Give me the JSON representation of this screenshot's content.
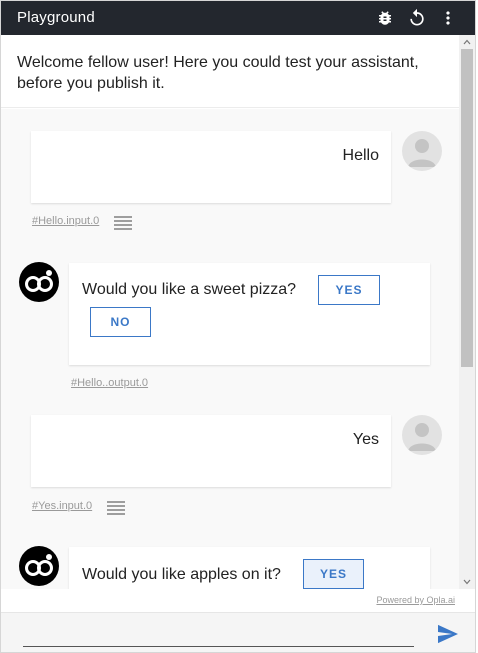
{
  "header": {
    "title": "Playground",
    "bug_icon": "bug-icon",
    "reset_icon": "restart-icon",
    "menu_icon": "more-vert-icon"
  },
  "welcome": {
    "text": "Welcome fellow user! Here you could test your assistant, before you publish it."
  },
  "messages": [
    {
      "from": "user",
      "text": "Hello",
      "tag": "#Hello.input.0"
    },
    {
      "from": "bot",
      "text": "Would you like a sweet pizza?",
      "buttons": [
        "YES",
        "NO"
      ],
      "tag": "#Hello..output.0"
    },
    {
      "from": "user",
      "text": "Yes",
      "tag": "#Yes.input.0"
    },
    {
      "from": "bot",
      "text": "Would you like apples on it?",
      "buttons": [
        "YES"
      ]
    }
  ],
  "footer": {
    "powered_by": "Powered by Opla.ai",
    "input_value": "",
    "input_placeholder": "",
    "send_icon": "send-icon"
  },
  "colors": {
    "header_bg": "#23272e",
    "accent": "#3b78c7",
    "convo_bg": "#f9f9f9"
  }
}
